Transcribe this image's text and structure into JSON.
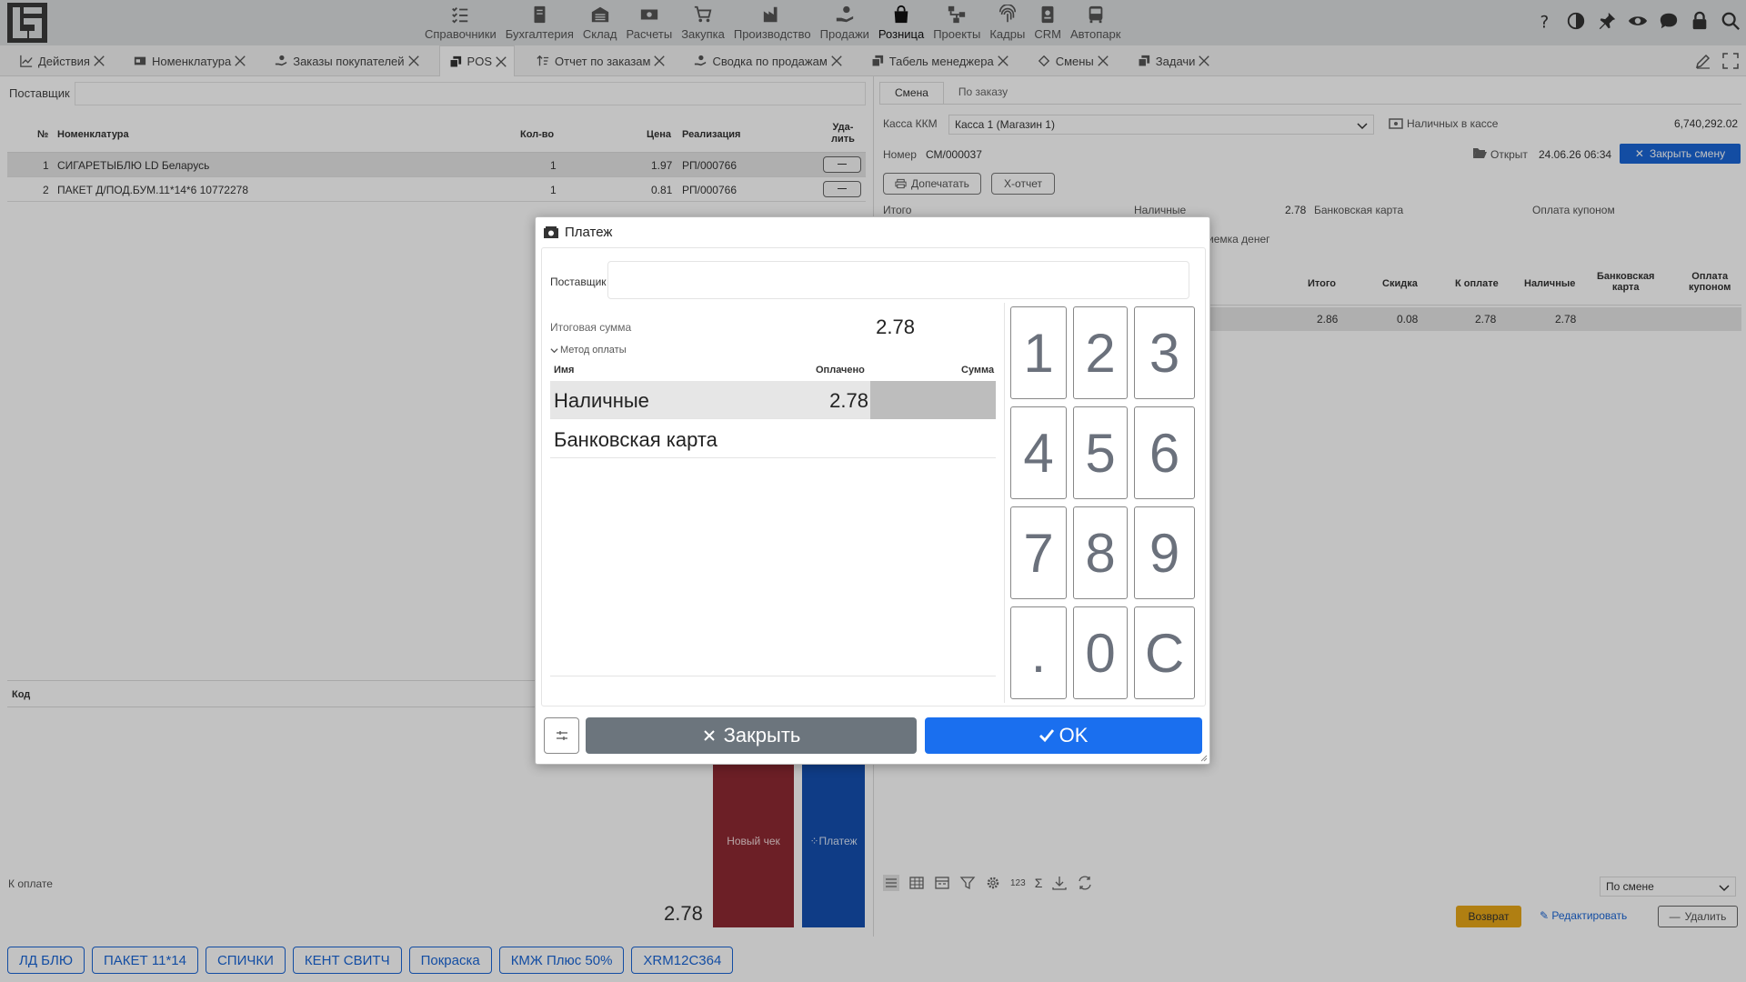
{
  "nav": {
    "items": [
      {
        "label": "Справочники",
        "icon": "list-check-icon"
      },
      {
        "label": "Бухгалтерия",
        "icon": "book-icon"
      },
      {
        "label": "Склад",
        "icon": "warehouse-icon"
      },
      {
        "label": "Расчеты",
        "icon": "cash-icon"
      },
      {
        "label": "Закупка",
        "icon": "cart-icon"
      },
      {
        "label": "Производство",
        "icon": "factory-icon"
      },
      {
        "label": "Продажи",
        "icon": "hand-money-icon"
      },
      {
        "label": "Розница",
        "icon": "shopping-bag-icon"
      },
      {
        "label": "Проекты",
        "icon": "diagram-icon"
      },
      {
        "label": "Кадры",
        "icon": "fingerprint-icon"
      },
      {
        "label": "CRM",
        "icon": "badge-icon"
      },
      {
        "label": "Автопарк",
        "icon": "bus-icon"
      }
    ]
  },
  "tabs": [
    {
      "label": "Действия",
      "icon": "chart-line-icon"
    },
    {
      "label": "Номенклатура",
      "icon": "card-icon"
    },
    {
      "label": "Заказы покупателей",
      "icon": "hand-icon"
    },
    {
      "label": "POS",
      "icon": "copy-icon"
    },
    {
      "label": "Отчет по заказам",
      "icon": "sort-icon"
    },
    {
      "label": "Сводка по продажам",
      "icon": "hand-icon"
    },
    {
      "label": "Табель менеджера",
      "icon": "copy-icon"
    },
    {
      "label": "Смены",
      "icon": "diamond-icon"
    },
    {
      "label": "Задачи",
      "icon": "copy-icon"
    }
  ],
  "left": {
    "supplier_label": "Поставщик",
    "table": {
      "headers": {
        "num": "№",
        "name": "Номенклатура",
        "qty": "Кол-во",
        "price": "Цена",
        "realization": "Реализация",
        "delete": "Уда-\nлить"
      },
      "rows": [
        {
          "num": "1",
          "name": "СИГАРЕТЫБЛЮ LD Беларусь",
          "qty": "1",
          "price": "1.97",
          "realization": "РП/000766"
        },
        {
          "num": "2",
          "name": "ПАКЕТ Д/ПОД.БУМ.11*14*6 10772278",
          "qty": "1",
          "price": "0.81",
          "realization": "РП/000766"
        }
      ]
    },
    "code_label": "Код",
    "to_pay_label": "К оплате",
    "to_pay_value": "2.78",
    "new_check_label": "Новый чек",
    "payment_label": "Платеж"
  },
  "right": {
    "tabs": [
      "Смена",
      "По заказу"
    ],
    "kassa_label": "Касса ККМ",
    "kassa_value": "Касса 1 (Магазин 1)",
    "cash_label": "Наличных в кассе",
    "cash_value": "6,740,292.02",
    "number_label": "Номер",
    "number_value": "СМ/000037",
    "opened_label": "Открыт",
    "opened_value": "24.06.26 06:34",
    "close_shift_label": "Закрыть смену",
    "reprint_label": "Допечатать",
    "xreport_label": "X-отчет",
    "totals": {
      "total_label": "Итого",
      "cash_label": "Наличные",
      "cash_value": "2.78",
      "card_label": "Банковская карта",
      "coupon_label": "Оплата купоном"
    },
    "money_receipt_label": "иемка денег",
    "summary_headers": {
      "total": "Итого",
      "discount": "Скидка",
      "to_pay": "К оплате",
      "cash": "Наличные",
      "card": "Банковская\nкарта",
      "coupon": "Оплата\nкупоном"
    },
    "summary_row": {
      "total": "2.86",
      "discount": "0.08",
      "to_pay": "2.78",
      "cash": "2.78",
      "card": "",
      "coupon": ""
    },
    "counter_label": "123",
    "sigma_label": "Σ",
    "period_value": "По смене",
    "return_label": "Возврат",
    "edit_label": "Редактировать",
    "delete_label": "Удалить"
  },
  "quick_buttons": [
    "ЛД БЛЮ",
    "ПАКЕТ 11*14",
    "СПИЧКИ",
    "КЕНТ СВИТЧ",
    "Покраска",
    "КМЖ Плюс 50%",
    "XRM12C364"
  ],
  "modal": {
    "title": "Платеж",
    "supplier_label": "Поставщик",
    "total_label": "Итоговая сумма",
    "total_value": "2.78",
    "method_label": "Метод оплаты",
    "headers": {
      "name": "Имя",
      "paid": "Оплачено",
      "amount": "Сумма"
    },
    "methods": [
      {
        "name": "Наличные",
        "paid": "2.78"
      },
      {
        "name": "Банковская карта",
        "paid": ""
      }
    ],
    "keys": [
      "1",
      "2",
      "3",
      "4",
      "5",
      "6",
      "7",
      "8",
      "9",
      ".",
      "0",
      "C"
    ],
    "close_label": "Закрыть",
    "ok_label": "OK"
  },
  "colors": {
    "primary": "#1a6fef",
    "secondary": "#6c757d",
    "new_check": "#8f2a33",
    "payment": "#1550b0",
    "return": "#e8a818"
  }
}
